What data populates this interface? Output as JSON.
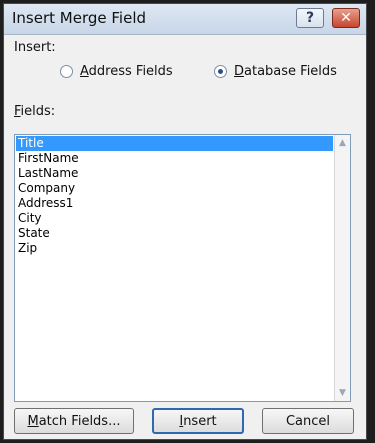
{
  "dialog": {
    "title": "Insert Merge Field",
    "help_symbol": "?",
    "close_symbol": "✕"
  },
  "insert": {
    "label": "Insert:",
    "options": [
      {
        "label_mn": "A",
        "label_rest": "ddress Fields",
        "checked": false
      },
      {
        "label_mn": "D",
        "label_rest": "atabase Fields",
        "checked": true
      }
    ]
  },
  "fields": {
    "label_mn": "F",
    "label_rest": "ields:",
    "items": [
      "Title",
      "FirstName",
      "LastName",
      "Company",
      "Address1",
      "City",
      "State",
      "Zip"
    ],
    "selected_index": 0,
    "scroll_up_symbol": "▲",
    "scroll_down_symbol": "▼"
  },
  "buttons": {
    "match_mn": "M",
    "match_rest": "atch Fields...",
    "insert_mn": "I",
    "insert_rest": "nsert",
    "cancel": "Cancel"
  },
  "colors": {
    "selection": "#3399ff",
    "close_button": "#c7462f"
  }
}
